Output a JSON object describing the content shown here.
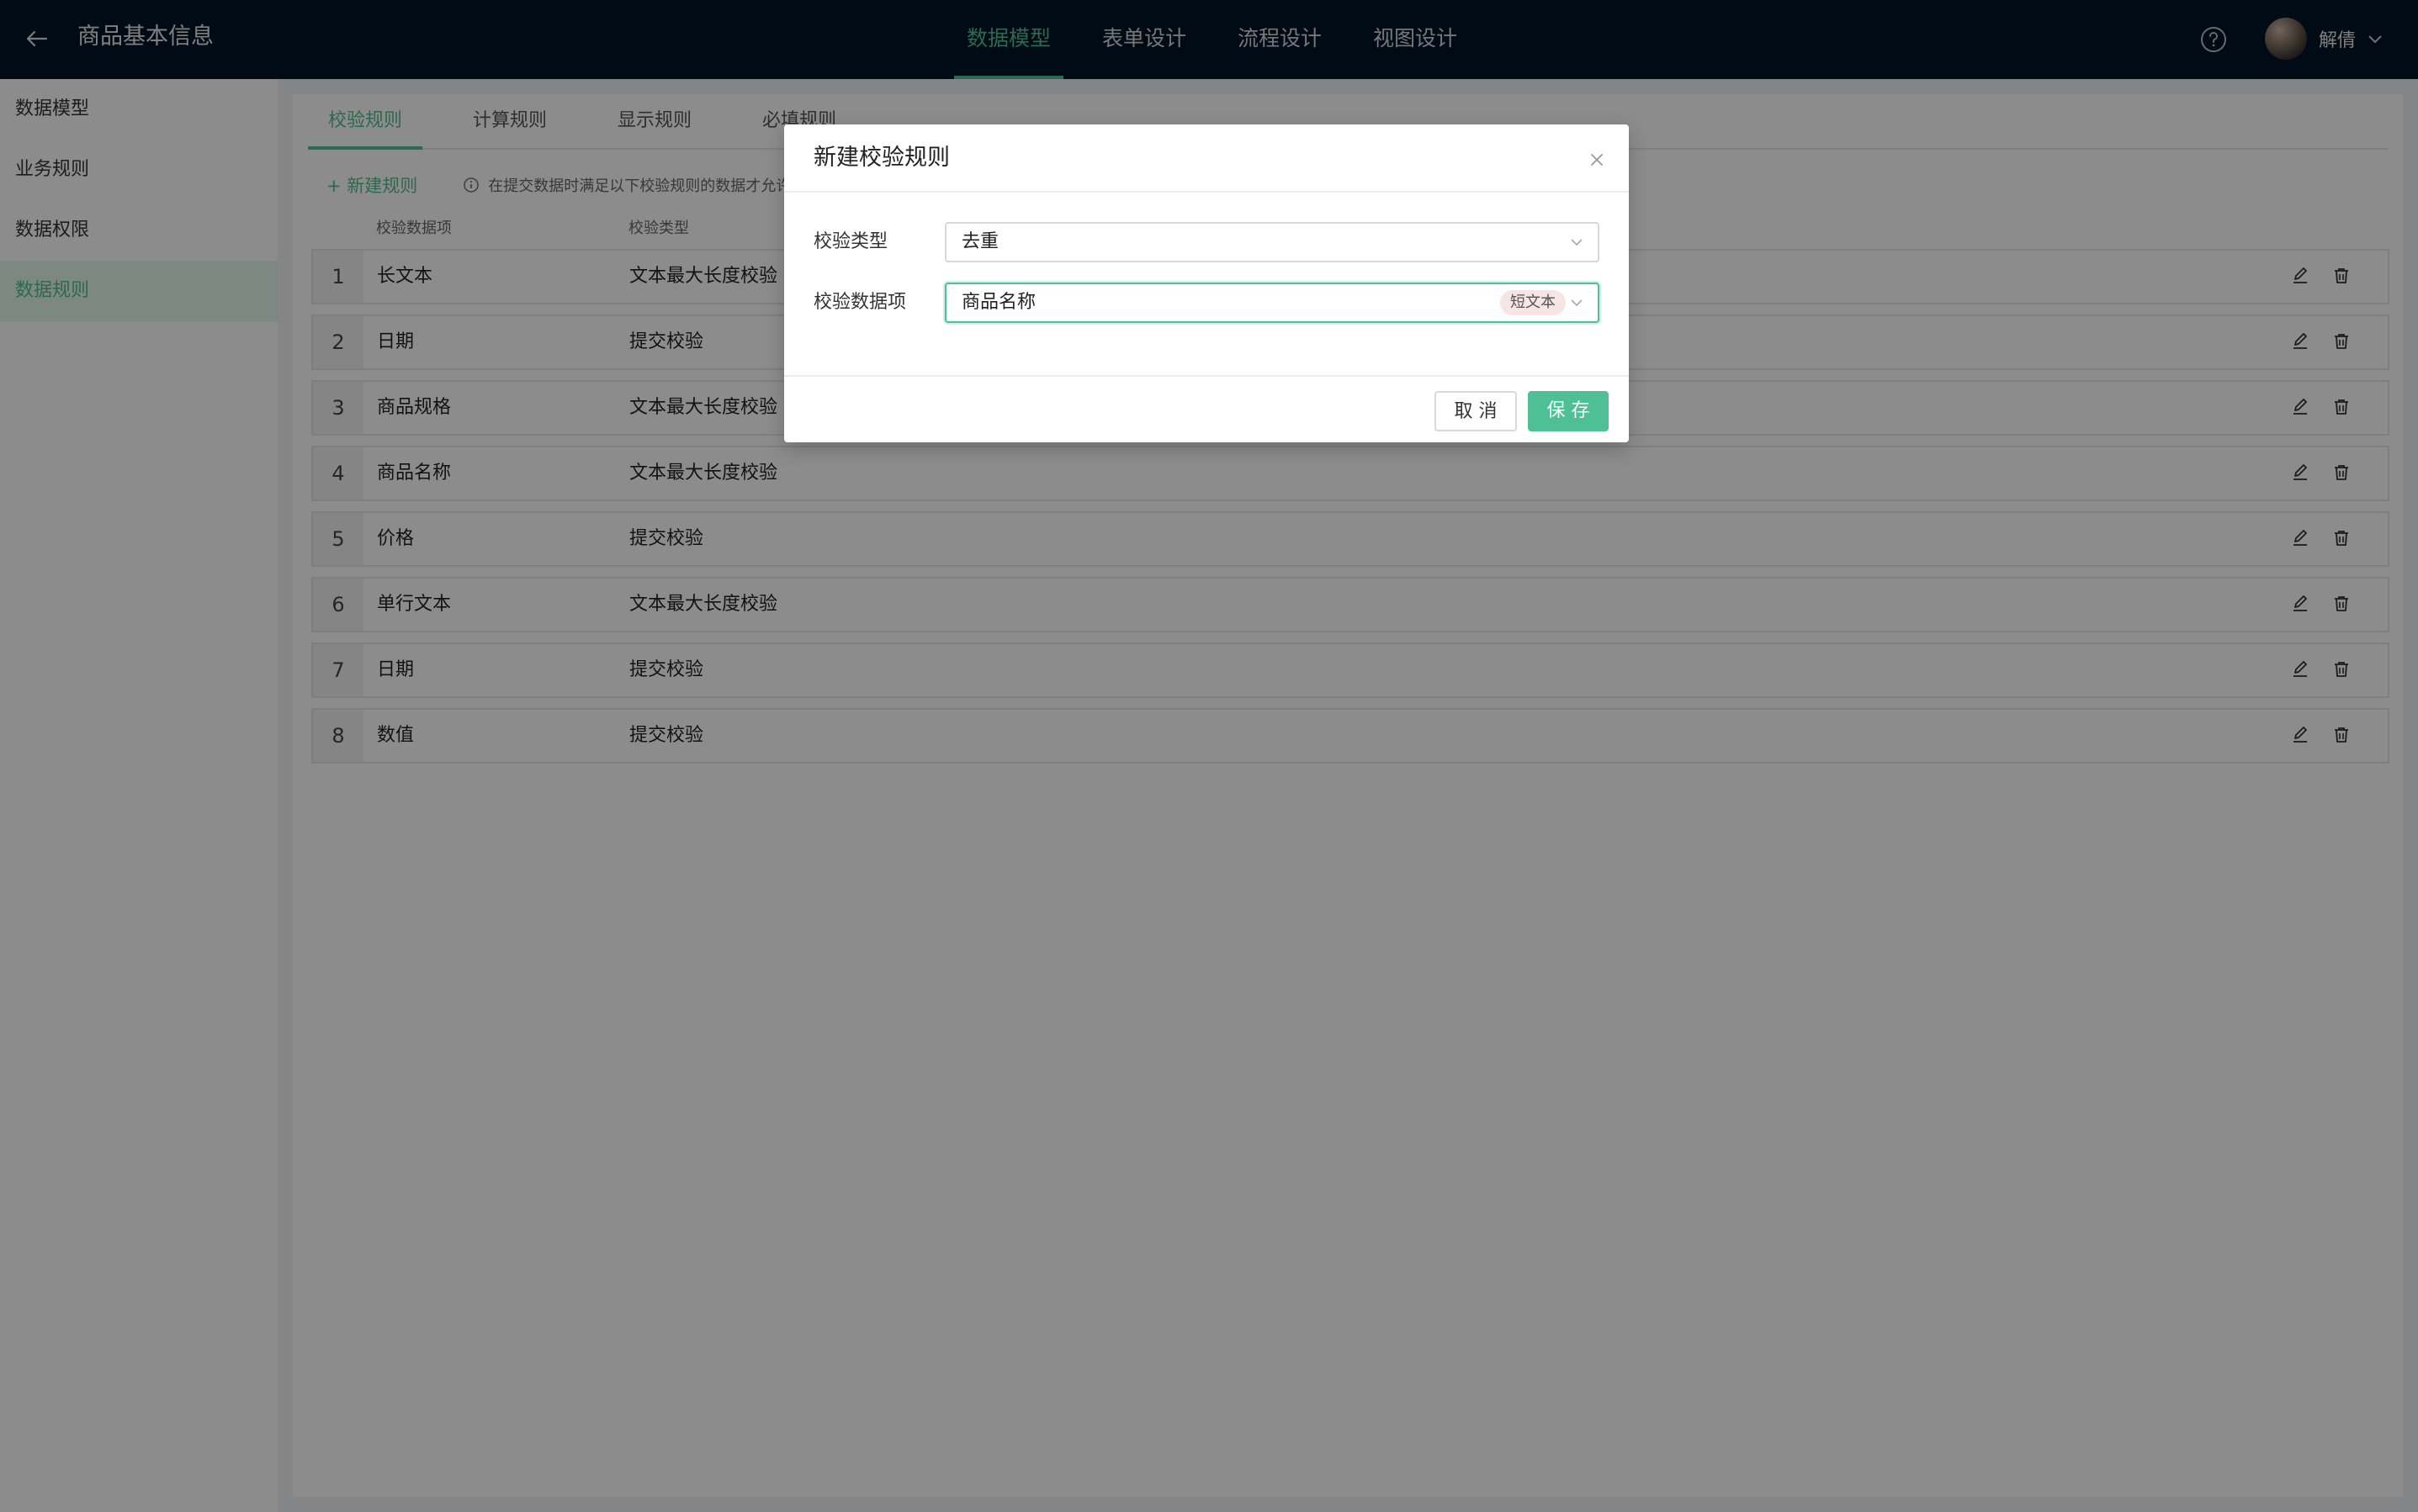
{
  "header": {
    "title": "商品基本信息",
    "nav": [
      "数据模型",
      "表单设计",
      "流程设计",
      "视图设计"
    ],
    "active_nav": 0,
    "user_name": "解倩"
  },
  "sidebar": {
    "items": [
      "数据模型",
      "业务规则",
      "数据权限",
      "数据规则"
    ],
    "active": 3
  },
  "main": {
    "tabs": [
      "校验规则",
      "计算规则",
      "显示规则",
      "必填规则"
    ],
    "active_tab": 0,
    "new_rule_label": "+ 新建规则",
    "info_text": "在提交数据时满足以下校验规则的数据才允许",
    "columns": [
      "校验数据项",
      "校验类型"
    ],
    "rows": [
      {
        "index": "1",
        "field": "长文本",
        "type": "文本最大长度校验"
      },
      {
        "index": "2",
        "field": "日期",
        "type": "提交校验"
      },
      {
        "index": "3",
        "field": "商品规格",
        "type": "文本最大长度校验"
      },
      {
        "index": "4",
        "field": "商品名称",
        "type": "文本最大长度校验"
      },
      {
        "index": "5",
        "field": "价格",
        "type": "提交校验"
      },
      {
        "index": "6",
        "field": "单行文本",
        "type": "文本最大长度校验"
      },
      {
        "index": "7",
        "field": "日期",
        "type": "提交校验"
      },
      {
        "index": "8",
        "field": "数值",
        "type": "提交校验"
      }
    ]
  },
  "modal": {
    "title": "新建校验规则",
    "type_label": "校验类型",
    "type_value": "去重",
    "field_label": "校验数据项",
    "field_value": "商品名称",
    "field_tag": "短文本",
    "cancel_label": "取 消",
    "save_label": "保 存"
  },
  "colors": {
    "accent": "#4fbf95",
    "header_bg": "#001529",
    "tag_bg": "#f7e4e4"
  },
  "icons": {
    "back": "arrow-left-icon",
    "help": "question-circle-icon",
    "chevron": "chevron-down-icon",
    "info": "info-circle-icon",
    "edit": "pencil-icon",
    "delete": "trash-icon",
    "close": "close-icon"
  }
}
